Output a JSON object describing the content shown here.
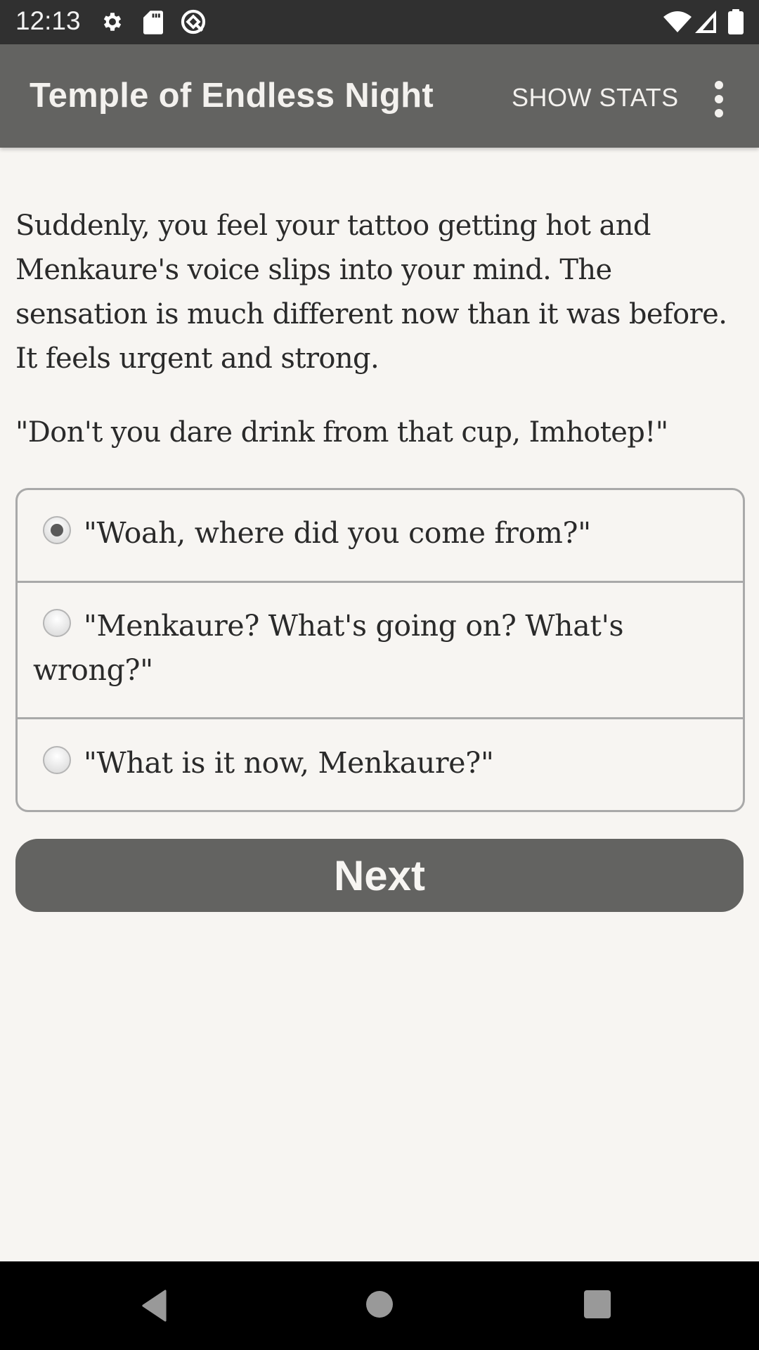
{
  "status_bar": {
    "time": "12:13",
    "left_icons": [
      "settings-icon",
      "sd-card-icon",
      "data-saver-icon"
    ],
    "right_icons": [
      "wifi-icon",
      "signal-icon",
      "battery-icon"
    ]
  },
  "app_bar": {
    "title": "Temple of Endless Night",
    "show_stats_label": "SHOW STATS",
    "overflow_icon": "more-vert-icon"
  },
  "story": {
    "paragraphs": [
      "Suddenly, you feel your tattoo getting hot and Menkaure's voice slips into your mind. The sensation is much different now than it was before. It feels urgent and strong.",
      "\"Don't you dare drink from that cup, Imhotep!\""
    ]
  },
  "choices": [
    {
      "label": "\"Woah, where did you come from?\"",
      "selected": true
    },
    {
      "label": "\"Menkaure? What's going on? What's wrong?\"",
      "selected": false
    },
    {
      "label": "\"What is it now, Menkaure?\"",
      "selected": false
    }
  ],
  "next_button": {
    "label": "Next"
  },
  "nav_bar": {
    "buttons": [
      "back",
      "home",
      "recents"
    ]
  },
  "colors": {
    "status_bar": "#303030",
    "app_bar": "#636361",
    "background": "#f7f5f2",
    "button": "#636361",
    "border": "#a9a9a9",
    "text": "#2a2a2a"
  }
}
